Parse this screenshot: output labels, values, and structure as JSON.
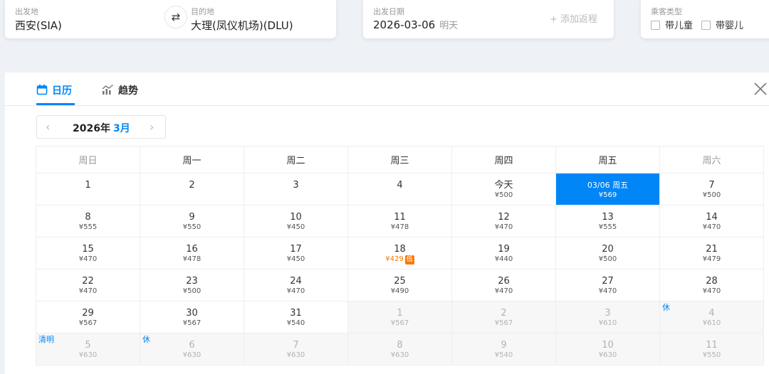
{
  "search": {
    "origin_label": "出发地",
    "origin_value": "西安(SIA)",
    "dest_label": "目的地",
    "dest_value": "大理(凤仪机场)(DLU)",
    "date_label": "出发日期",
    "date_value": "2026-03-06",
    "date_hint": "明天",
    "add_return": "+ 添加返程",
    "passenger_label": "乘客类型",
    "child_label": "带儿童",
    "infant_label": "带婴儿"
  },
  "tabs": [
    {
      "label": "日历",
      "icon": "calendar-icon",
      "active": true
    },
    {
      "label": "趋势",
      "icon": "trend-chart-icon",
      "active": false
    }
  ],
  "month_nav": {
    "year": "2026年",
    "month": "3月"
  },
  "weekdays": [
    "周日",
    "周一",
    "周二",
    "周三",
    "周四",
    "周五",
    "周六"
  ],
  "weeks": [
    [
      {
        "day": "1"
      },
      {
        "day": "2"
      },
      {
        "day": "3"
      },
      {
        "day": "4"
      },
      {
        "day": "今天",
        "price": "¥500"
      },
      {
        "day": "03/06 周五",
        "price": "¥569",
        "selected": true
      },
      {
        "day": "7",
        "price": "¥500"
      }
    ],
    [
      {
        "day": "8",
        "price": "¥555"
      },
      {
        "day": "9",
        "price": "¥550"
      },
      {
        "day": "10",
        "price": "¥450"
      },
      {
        "day": "11",
        "price": "¥478"
      },
      {
        "day": "12",
        "price": "¥470"
      },
      {
        "day": "13",
        "price": "¥555"
      },
      {
        "day": "14",
        "price": "¥470"
      }
    ],
    [
      {
        "day": "15",
        "price": "¥470"
      },
      {
        "day": "16",
        "price": "¥478"
      },
      {
        "day": "17",
        "price": "¥450"
      },
      {
        "day": "18",
        "price": "¥429",
        "low": true,
        "badge": "低"
      },
      {
        "day": "19",
        "price": "¥440"
      },
      {
        "day": "20",
        "price": "¥500"
      },
      {
        "day": "21",
        "price": "¥479"
      }
    ],
    [
      {
        "day": "22",
        "price": "¥470"
      },
      {
        "day": "23",
        "price": "¥500"
      },
      {
        "day": "24",
        "price": "¥470"
      },
      {
        "day": "25",
        "price": "¥490"
      },
      {
        "day": "26",
        "price": "¥470"
      },
      {
        "day": "27",
        "price": "¥470"
      },
      {
        "day": "28",
        "price": "¥470"
      }
    ],
    [
      {
        "day": "29",
        "price": "¥567"
      },
      {
        "day": "30",
        "price": "¥567"
      },
      {
        "day": "31",
        "price": "¥540"
      },
      {
        "day": "1",
        "price": "¥567",
        "other": true
      },
      {
        "day": "2",
        "price": "¥567",
        "other": true
      },
      {
        "day": "3",
        "price": "¥610",
        "other": true
      },
      {
        "day": "4",
        "price": "¥610",
        "other": true,
        "tag": "休"
      }
    ],
    [
      {
        "day": "5",
        "price": "¥630",
        "other": true,
        "tag": "清明"
      },
      {
        "day": "6",
        "price": "¥630",
        "other": true,
        "tag": "休"
      },
      {
        "day": "7",
        "price": "¥630",
        "other": true
      },
      {
        "day": "8",
        "price": "¥630",
        "other": true
      },
      {
        "day": "9",
        "price": "¥540",
        "other": true
      },
      {
        "day": "10",
        "price": "¥630",
        "other": true
      },
      {
        "day": "11",
        "price": "¥550",
        "other": true
      }
    ]
  ],
  "colors": {
    "accent": "#0086f6",
    "low_price": "#ff7700"
  }
}
